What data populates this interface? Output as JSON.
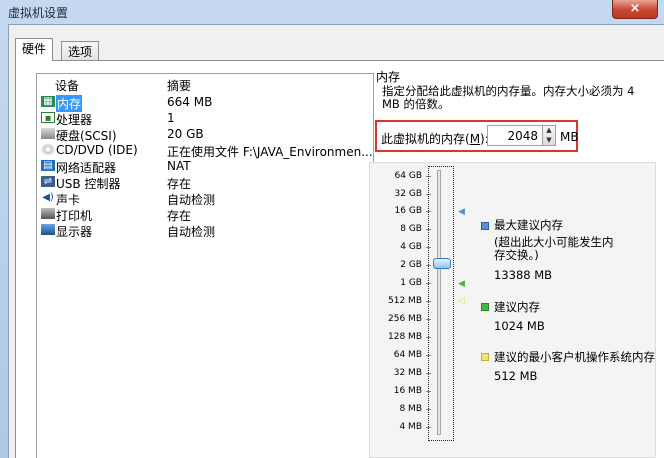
{
  "window": {
    "title": "虚拟机设置",
    "close_glyph": "×"
  },
  "tabs": [
    {
      "label": "硬件"
    },
    {
      "label": "选项"
    }
  ],
  "device_list": {
    "header_device": "设备",
    "header_summary": "摘要",
    "rows": [
      {
        "name": "内存",
        "summary": "664 MB",
        "icon": "memory-icon",
        "selected": true
      },
      {
        "name": "处理器",
        "summary": "1",
        "icon": "processor-icon"
      },
      {
        "name": "硬盘(SCSI)",
        "summary": "20 GB",
        "icon": "harddisk-icon"
      },
      {
        "name": "CD/DVD (IDE)",
        "summary": "正在使用文件 F:\\JAVA_Environmen...",
        "icon": "cdrom-icon"
      },
      {
        "name": "网络适配器",
        "summary": "NAT",
        "icon": "network-icon"
      },
      {
        "name": "USB 控制器",
        "summary": "存在",
        "icon": "usb-icon"
      },
      {
        "name": "声卡",
        "summary": "自动检测",
        "icon": "sound-icon"
      },
      {
        "name": "打印机",
        "summary": "存在",
        "icon": "printer-icon"
      },
      {
        "name": "显示器",
        "summary": "自动检测",
        "icon": "display-icon"
      }
    ]
  },
  "memory": {
    "title": "内存",
    "description": "指定分配给此虚拟机的内存量。内存大小必须为 4 MB 的倍数。",
    "label_prefix": "此虚拟机的内存(",
    "label_key": "M",
    "label_suffix": "):",
    "value": "2048",
    "unit": "MB",
    "scale": [
      "64 GB",
      "32 GB",
      "16 GB",
      "8 GB",
      "4 GB",
      "2 GB",
      "1 GB",
      "512 MB",
      "256 MB",
      "128 MB",
      "64 MB",
      "32 MB",
      "16 MB",
      "8 MB",
      "4 MB"
    ],
    "slider_value": "2 GB",
    "legend": [
      {
        "label": "最大建议内存",
        "note": "(超出此大小可能发生内存交换。)",
        "value": "13388 MB",
        "color": "#5b8fd0"
      },
      {
        "label": "建议内存",
        "value": "1024 MB",
        "color": "#44b844"
      },
      {
        "label": "建议的最小客户机操作系统内存",
        "value": "512 MB",
        "color": "#e8d64a"
      }
    ]
  }
}
